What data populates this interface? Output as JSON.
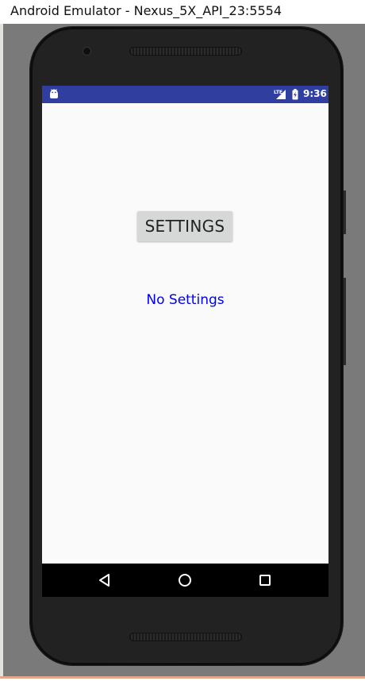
{
  "window": {
    "title": "Android Emulator - Nexus_5X_API_23:5554"
  },
  "status_bar": {
    "time": "9:36",
    "network": "LTE",
    "color": "#303f9f",
    "icons": [
      "android-icon",
      "lte-signal-icon",
      "battery-icon"
    ]
  },
  "app": {
    "settings_button_label": "SETTINGS",
    "status_text": "No Settings",
    "status_text_color": "#0000ee",
    "background": "#fafafa"
  },
  "nav_bar": {
    "buttons": [
      "back-icon",
      "home-icon",
      "recents-icon"
    ]
  }
}
